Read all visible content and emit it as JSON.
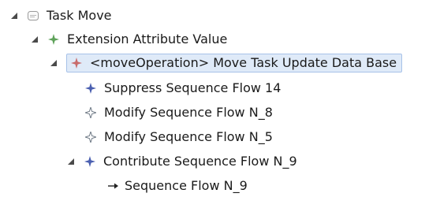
{
  "tree": {
    "root": {
      "label": "Task Move",
      "icon": "task-icon",
      "expanded": true
    },
    "extension": {
      "label": "Extension Attribute Value",
      "icon": "green-star-icon",
      "expanded": true
    },
    "move_operation": {
      "label": "<moveOperation> Move Task Update Data Base",
      "icon": "red-star-icon",
      "expanded": true,
      "selected": true
    },
    "children": [
      {
        "label": "Suppress Sequence Flow 14",
        "icon": "blue-star-icon"
      },
      {
        "label": "Modify Sequence Flow N_8",
        "icon": "gray-star-icon"
      },
      {
        "label": "Modify Sequence Flow N_5",
        "icon": "gray-star-icon"
      },
      {
        "label": "Contribute Sequence Flow N_9",
        "icon": "blue-star-icon",
        "expanded": true
      }
    ],
    "grandchild": {
      "label": "Sequence Flow N_9",
      "icon": "arrow-right-icon"
    }
  },
  "colors": {
    "twisty": "#4a4a4a",
    "green_star": "#5ea25a",
    "red_star": "#c86b6b",
    "blue_star": "#4a5fb0",
    "gray_star": "#6f7a86",
    "selection_bg": "#dfeaf8",
    "selection_border": "#a7c2e8"
  }
}
